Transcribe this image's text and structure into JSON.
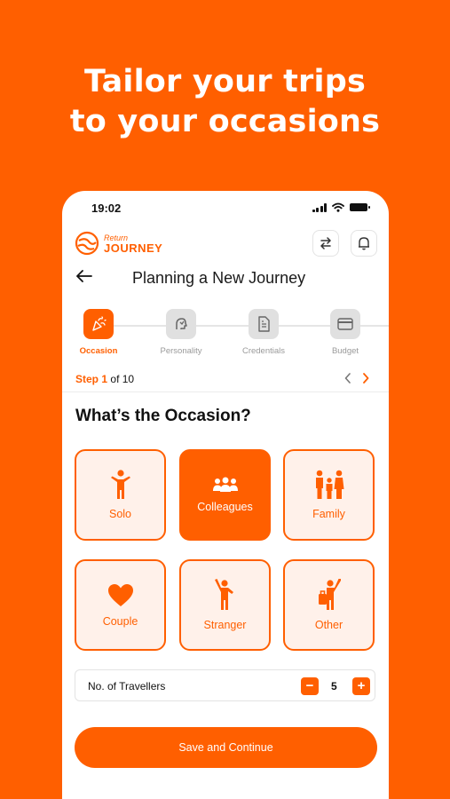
{
  "headline": {
    "line1": "Tailor your trips",
    "line2": "to your occasions"
  },
  "status_bar": {
    "time": "19:02"
  },
  "brand": {
    "small": "Return",
    "big": "JOURNEY"
  },
  "page": {
    "title": "Planning a New Journey"
  },
  "steps": [
    {
      "label": "Occasion",
      "icon": "party-popper-icon",
      "active": true
    },
    {
      "label": "Personality",
      "icon": "personality-icon",
      "active": false
    },
    {
      "label": "Credentials",
      "icon": "document-icon",
      "active": false
    },
    {
      "label": "Budget",
      "icon": "credit-card-icon",
      "active": false
    }
  ],
  "step_counter": {
    "prefix": "Step",
    "current": "1",
    "suffix": "of 10"
  },
  "question": "What’s the Occasion?",
  "occasions": [
    {
      "label": "Solo",
      "icon": "person-icon",
      "selected": false
    },
    {
      "label": "Colleagues",
      "icon": "group-icon",
      "selected": true
    },
    {
      "label": "Family",
      "icon": "family-icon",
      "selected": false
    },
    {
      "label": "Couple",
      "icon": "heart-icon",
      "selected": false
    },
    {
      "label": "Stranger",
      "icon": "waving-person-icon",
      "selected": false
    },
    {
      "label": "Other",
      "icon": "person-with-bag-icon",
      "selected": false
    }
  ],
  "travellers": {
    "label": "No. of Travellers",
    "value": "5",
    "minus": "−",
    "plus": "+"
  },
  "save_button": "Save and Continue",
  "colors": {
    "accent": "#FF5F00",
    "card_bg": "#FFF1EA",
    "muted": "#9A9A9A"
  }
}
